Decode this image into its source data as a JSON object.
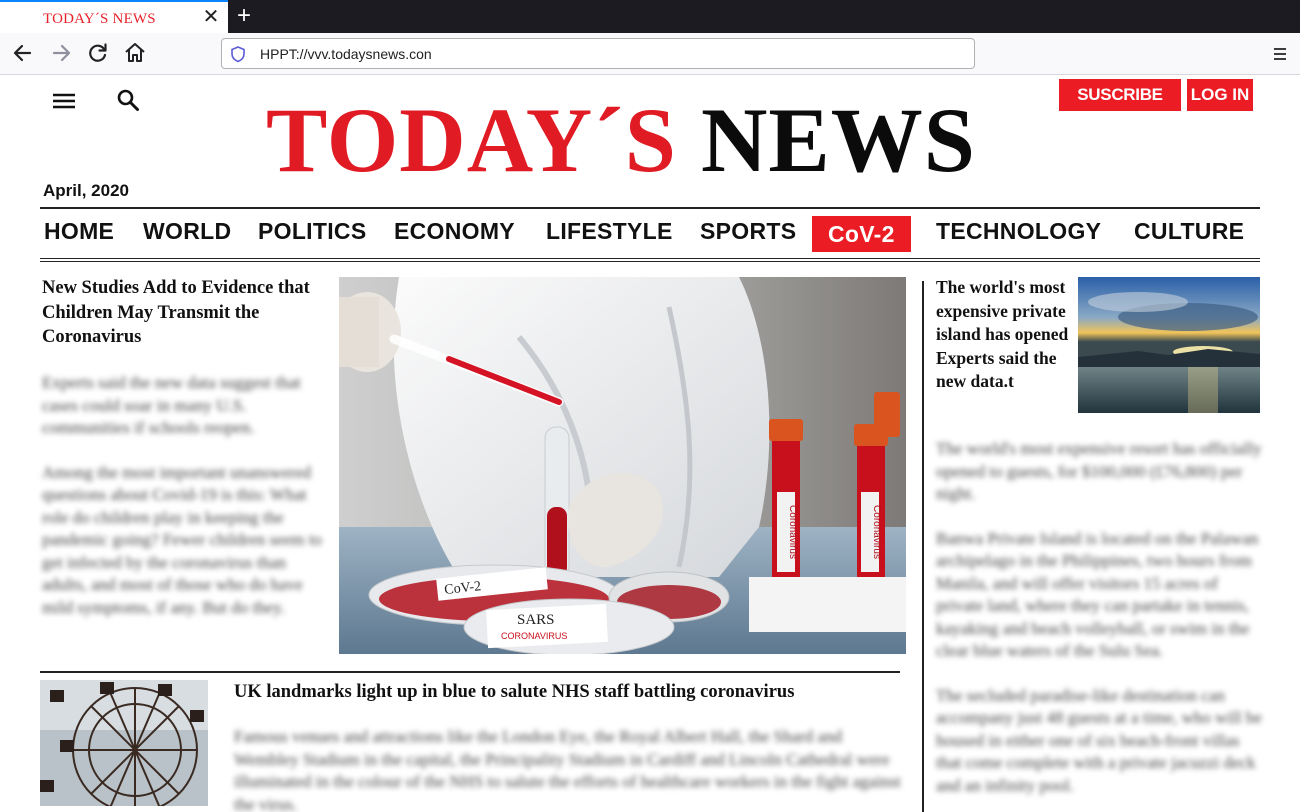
{
  "browser": {
    "tab_title": "TODAY´S NEWS",
    "tab_close": "✕",
    "new_tab": "+",
    "url": "HPPT://vvv.todaysnews.con"
  },
  "site": {
    "masthead_red": "TODAY´S",
    "masthead_black": "NEWS",
    "subscribe_label": "SUSCRIBE",
    "login_label": "LOG IN",
    "date": "April, 2020",
    "brand_red": "#e01b24"
  },
  "sections": [
    {
      "label": "HOME"
    },
    {
      "label": "WORLD"
    },
    {
      "label": "POLITICS"
    },
    {
      "label": "ECONOMY"
    },
    {
      "label": "LIFESTYLE"
    },
    {
      "label": "SPORTS"
    },
    {
      "label": "CoV-2",
      "active": true
    },
    {
      "label": "TECHNOLOGY"
    },
    {
      "label": "CULTURE"
    }
  ],
  "articles": {
    "lead": {
      "headline": "New Studies Add to Evidence that Children May Transmit the Coronavirus",
      "para1": "Experts said the new data suggest that cases could soar in many U.S. communities if schools reopen.",
      "para2": "Among the most important unanswered questions about Covid-19 is this: What role do children play in keeping the pandemic going? Fewer children seem to get infected by the coronavirus than adults, and most of those who do have mild symptoms, if any. But do they."
    },
    "hero": {
      "petri_label_1": "CoV-2",
      "petri_label_1_sub": "CORONAVIRUS",
      "petri_label_2": "SARS",
      "petri_label_2_sub": "CORONAVIRUS",
      "tube_label": "Coronavirus"
    },
    "island": {
      "headline": "The world's most expensive private island has opened Experts said the new data.t",
      "para1": "The world's most expensive resort has officially opened to guests, for $100,000 (£76,800) per night.",
      "para2": "Banwa Private Island is located on the Palawan archipelago in the Philippines, two hours from Manila, and will offer visitors 15 acres of private land, where they can partake in tennis, kayaking and beach volleyball, or swim in the clear blue waters of the Sulu Sea.",
      "para3": "The secluded paradise-like destination can accompany just 48 guests at a time, who will be housed in either one of six beach-front villas that come complete with a private jacuzzi deck and an infinity pool."
    },
    "landmarks": {
      "headline": "UK landmarks light up in blue to salute NHS staff battling coronavirus",
      "para1": "Famous venues and attractions like the London Eye, the Royal Albert Hall, the Shard and Wembley Stadium in the capital, the Principality Stadium in Cardiff and Lincoln Cathedral were illuminated in the colour of the NHS to salute the efforts of healthcare workers in the fight against the virus."
    }
  },
  "icons": [
    "back-arrow-icon",
    "forward-arrow-icon",
    "reload-icon",
    "home-icon",
    "shield-icon",
    "hamburger-menu-icon",
    "search-icon"
  ]
}
